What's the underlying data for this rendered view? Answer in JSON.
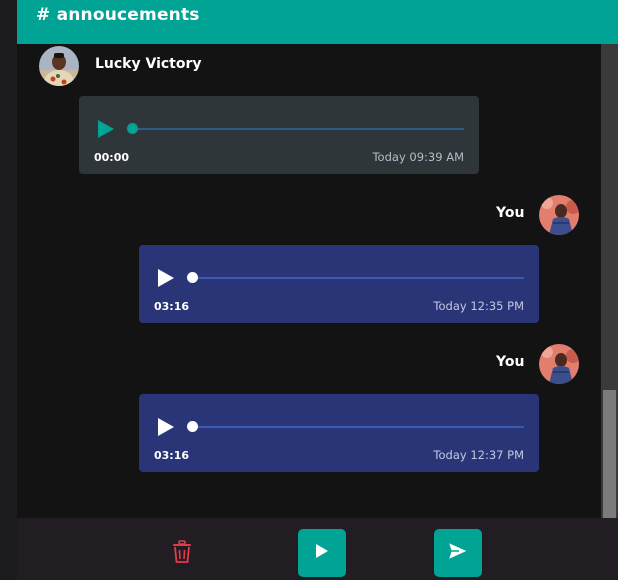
{
  "channel": {
    "title": "# annoucements"
  },
  "theme": {
    "accent": "#00a394",
    "mine_bubble": "#2a3578",
    "other_bubble": "#2f3639",
    "delete_color": "#e8394a"
  },
  "messages": [
    {
      "sender": "Lucky Victory",
      "duration": "00:00",
      "time": "Today 09:39 AM",
      "progress": 0,
      "icon": "play-icon"
    },
    {
      "sender": "You",
      "duration": "03:16",
      "time": "Today 12:35 PM",
      "progress": 0,
      "icon": "play-icon"
    },
    {
      "sender": "You",
      "duration": "03:16",
      "time": "Today 12:37 PM",
      "progress": 0,
      "icon": "play-icon"
    }
  ],
  "footer": {
    "delete_icon": "trash-icon",
    "play_icon": "play-icon",
    "send_icon": "send-icon"
  }
}
